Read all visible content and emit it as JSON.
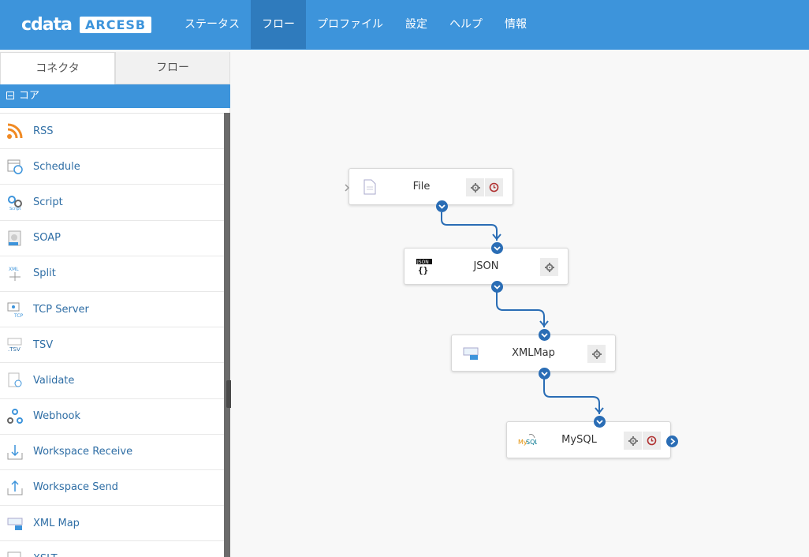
{
  "brand": {
    "logo_text": "cdata",
    "product": "ARCESB"
  },
  "nav": [
    "ステータス",
    "フロー",
    "プロファイル",
    "設定",
    "ヘルプ",
    "情報"
  ],
  "sidebar": {
    "tabs": [
      "コネクタ",
      "フロー"
    ],
    "group": "コア",
    "items": [
      {
        "label": "RSS",
        "icon": "rss-icon"
      },
      {
        "label": "Schedule",
        "icon": "schedule-icon"
      },
      {
        "label": "Script",
        "icon": "script-icon"
      },
      {
        "label": "SOAP",
        "icon": "soap-icon"
      },
      {
        "label": "Split",
        "icon": "split-icon"
      },
      {
        "label": "TCP Server",
        "icon": "tcp-server-icon"
      },
      {
        "label": "TSV",
        "icon": "tsv-icon"
      },
      {
        "label": "Validate",
        "icon": "validate-icon"
      },
      {
        "label": "Webhook",
        "icon": "webhook-icon"
      },
      {
        "label": "Workspace Receive",
        "icon": "workspace-receive-icon"
      },
      {
        "label": "Workspace Send",
        "icon": "workspace-send-icon"
      },
      {
        "label": "XML Map",
        "icon": "xml-map-icon"
      },
      {
        "label": "XSLT",
        "icon": "xslt-icon"
      }
    ]
  },
  "flow": {
    "nodes": [
      {
        "label": "File",
        "icon": "file-icon",
        "settings": true,
        "schedule": true
      },
      {
        "label": "JSON",
        "icon": "json-icon",
        "settings": true,
        "schedule": false
      },
      {
        "label": "XMLMap",
        "icon": "xmlmap-icon",
        "settings": true,
        "schedule": false
      },
      {
        "label": "MySQL",
        "icon": "mysql-icon",
        "settings": true,
        "schedule": true
      }
    ]
  },
  "colors": {
    "header": "#3d94db",
    "nav_active": "#2f7bbd",
    "port": "#2a6db5",
    "wire": "#2a6db5",
    "schedule": "#b03030"
  }
}
